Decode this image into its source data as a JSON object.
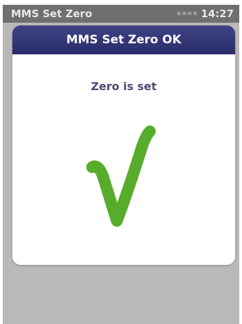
{
  "status_bar": {
    "app_title": "MMS Set Zero",
    "signal": "▪▪▪▪",
    "time": "14:27"
  },
  "dialog": {
    "title": "MMS Set Zero OK",
    "message": "Zero is set",
    "icon": "checkmark-icon",
    "icon_color": "#58ac2c"
  },
  "colors": {
    "header_bg": "#2e3170",
    "background": "#b9b9b9",
    "message_text": "#4a4a78"
  }
}
